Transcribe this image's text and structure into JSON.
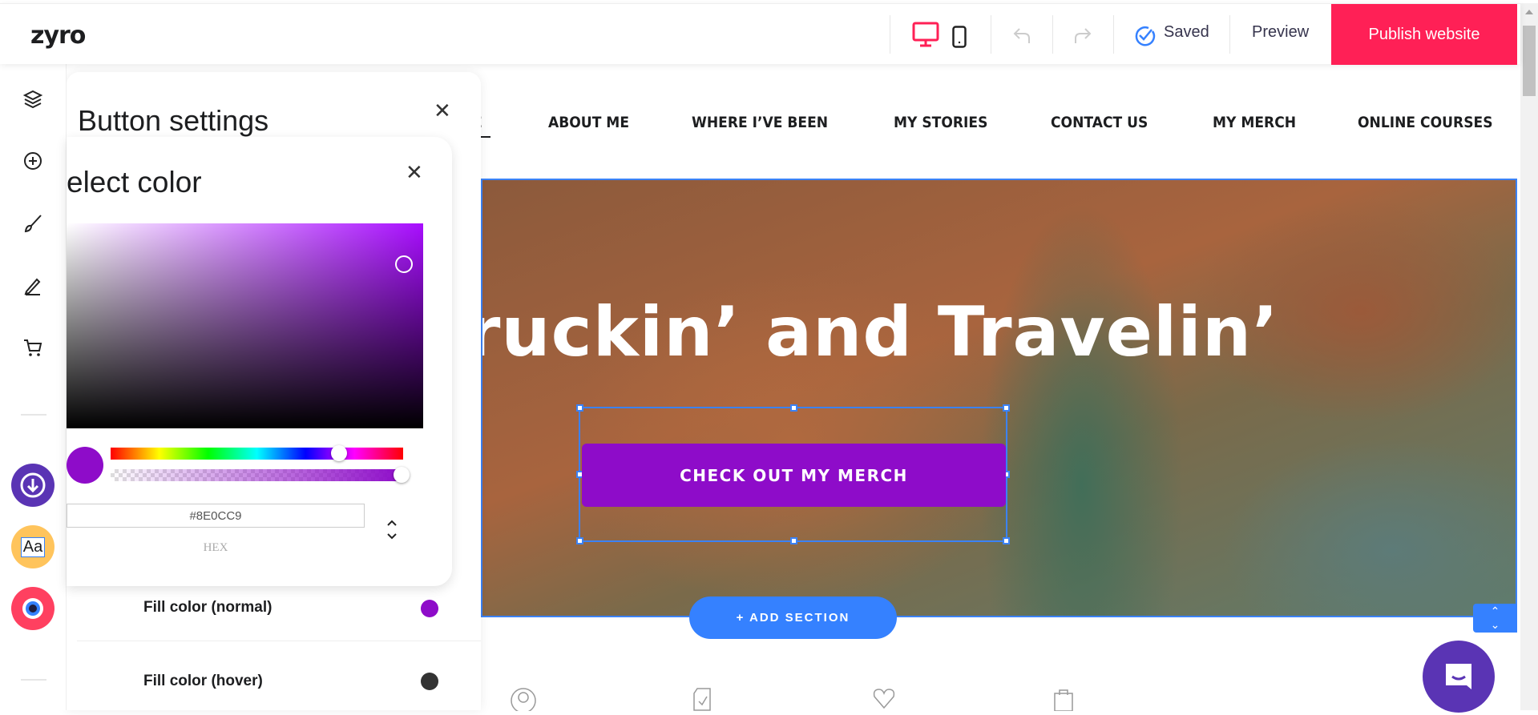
{
  "topbar": {
    "logo": "zyro",
    "saved_label": "Saved",
    "preview_label": "Preview",
    "publish_label": "Publish website",
    "accent": "#ff2056"
  },
  "panel": {
    "title": "Button settings"
  },
  "color_picker": {
    "title": "elect color",
    "hex_value": "#8E0CC9",
    "format_label": "HEX",
    "hue_position_percent": 78,
    "alpha_percent": 100
  },
  "fill_rows": [
    {
      "label": "Fill color (normal)",
      "color": "#8e0cc9"
    },
    {
      "label": "Fill color (hover)",
      "color": "#333333"
    }
  ],
  "site": {
    "nav": [
      "E",
      "ABOUT ME",
      "WHERE I’VE BEEN",
      "MY STORIES",
      "CONTACT US",
      "MY MERCH",
      "ONLINE COURSES"
    ],
    "hero_title": "ruckin’ and Travelin’",
    "cta_label": "CHECK OUT MY MERCH",
    "add_section_label": "+ ADD SECTION"
  },
  "icons": {
    "sidebar": [
      "layers-icon",
      "add-circle-icon",
      "brush-icon",
      "pen-icon",
      "cart-icon"
    ],
    "bottom": [
      "user-icon",
      "document-check-icon",
      "heart-icon",
      "shopping-bag-icon"
    ]
  }
}
